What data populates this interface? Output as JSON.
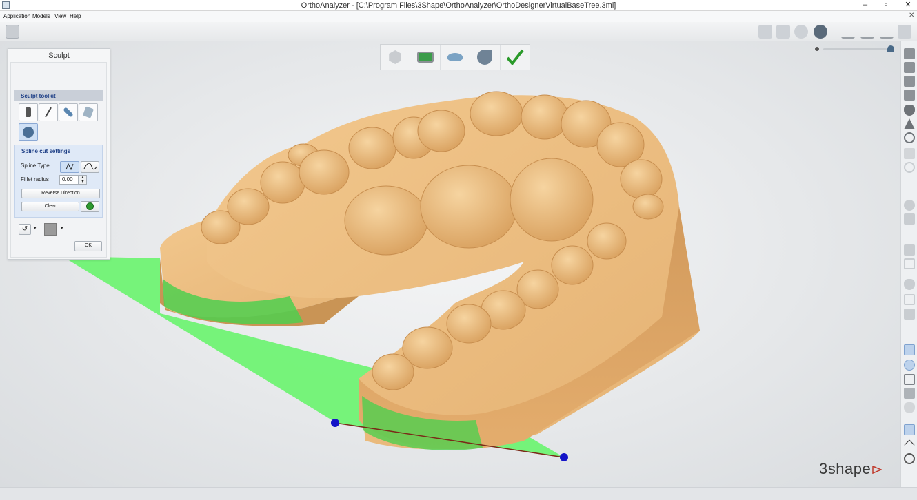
{
  "window": {
    "title": "OrthoAnalyzer - [C:\\Program Files\\3Shape\\OrthoAnalyzer\\OrthoDesignerVirtualBaseTree.3ml]",
    "controls": {
      "minimize": "–",
      "maximize": "▫",
      "close": "✕",
      "close_small": "✕"
    }
  },
  "menu": {
    "items": [
      "Application",
      "Models",
      "View",
      "Help"
    ]
  },
  "workflow": {
    "steps": [
      "model-step-icon",
      "scan-step-icon",
      "base-step-icon",
      "sculpt-step-icon",
      "checkmark-icon"
    ],
    "done_color": "#2a9a2a"
  },
  "sculpt_panel": {
    "title": "Sculpt",
    "toolkit_heading": "Sculpt toolkit",
    "tools": [
      "add-wax-icon",
      "knife-icon",
      "smooth-icon",
      "eraser-icon",
      "spline-cut-icon"
    ],
    "spline_settings": {
      "heading": "Spline cut settings",
      "spline_type_label": "Spline Type",
      "fillet_radius_label": "Fillet radius",
      "fillet_radius_value": "0.00",
      "reverse_button": "Reverse Direction",
      "clear_button": "Clear"
    },
    "ok_button": "OK"
  },
  "brand": {
    "name": "3shape",
    "accent_color": "#c0392b"
  },
  "colors": {
    "model": "#e8b374",
    "cut_plane": "#5cf060",
    "spline_point": "#1414c8"
  }
}
